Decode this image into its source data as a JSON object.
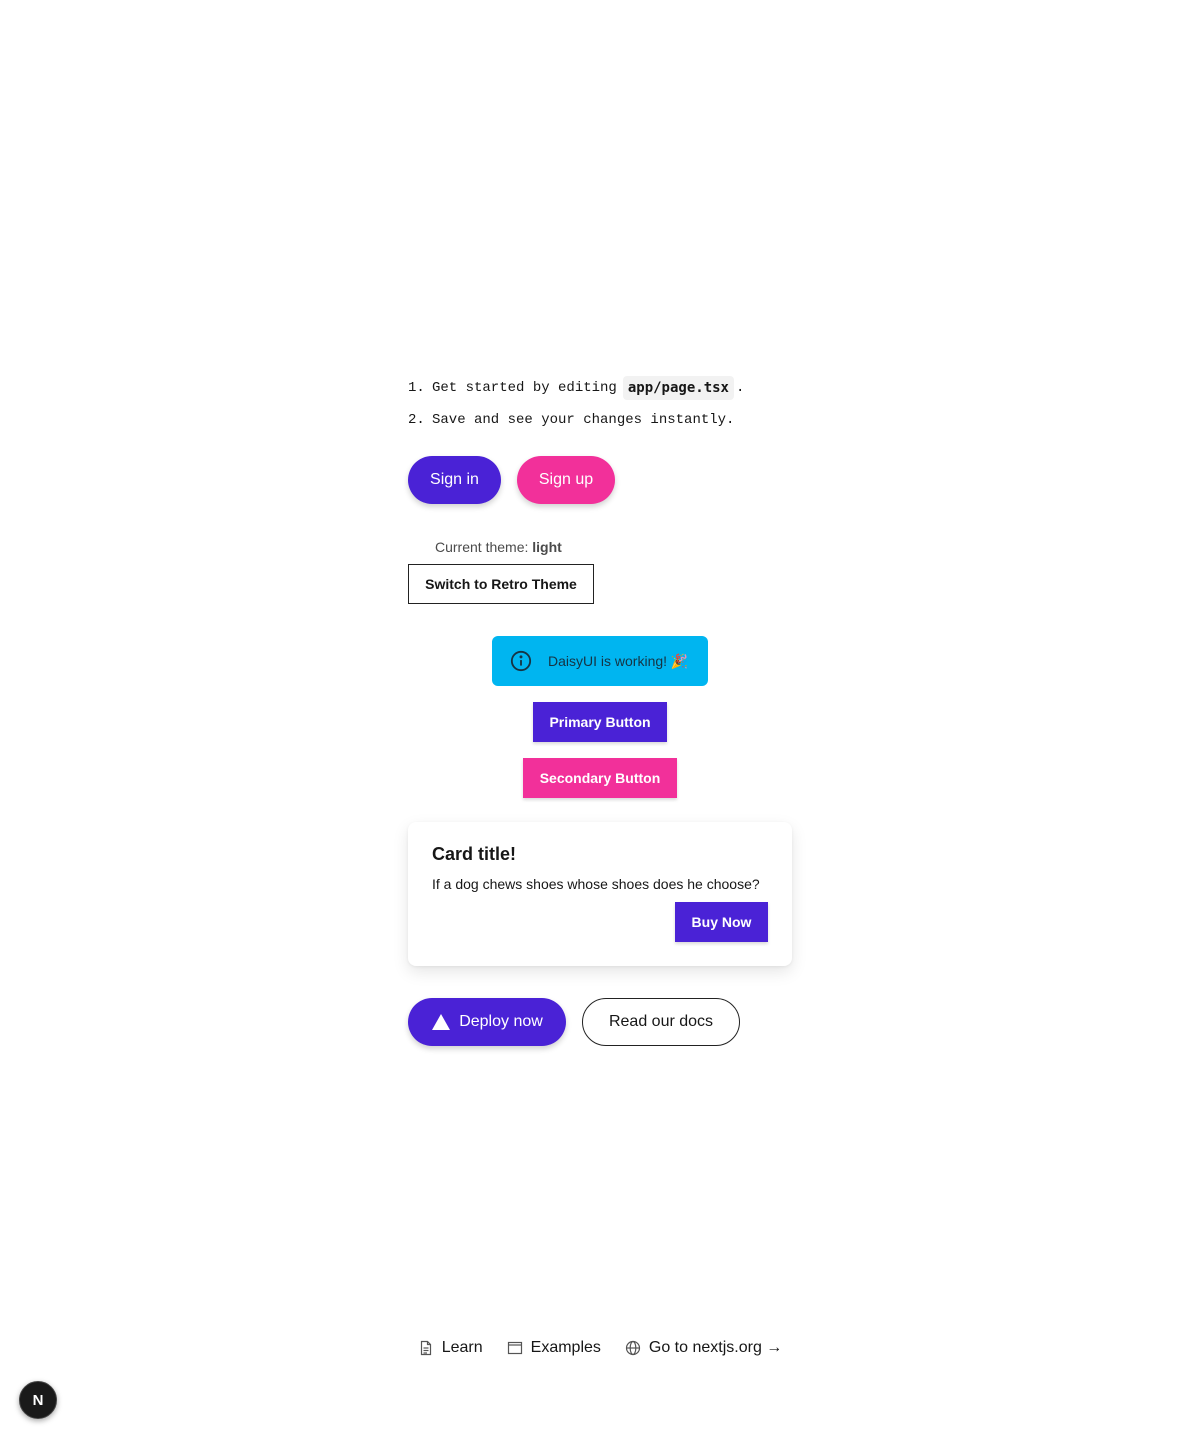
{
  "steps": {
    "item1_num": "1.",
    "item1_before": "Get started by editing",
    "item1_code": "app/page.tsx",
    "item1_after": ".",
    "item2_num": "2.",
    "item2_text": "Save and see your changes instantly."
  },
  "auth": {
    "sign_in": "Sign in",
    "sign_up": "Sign up"
  },
  "theme": {
    "label": "Current theme:",
    "value": "light",
    "switch_label": "Switch to Retro Theme"
  },
  "alert": {
    "text": "DaisyUI is working! 🎉",
    "icon": "info-icon",
    "color": "#00b5f0"
  },
  "buttons": {
    "primary": "Primary Button",
    "secondary": "Secondary Button"
  },
  "card": {
    "title": "Card title!",
    "text": "If a dog chews shoes whose shoes does he choose?",
    "action": "Buy Now"
  },
  "cta": {
    "deploy": "Deploy now",
    "docs": "Read our docs"
  },
  "footer": {
    "learn": "Learn",
    "examples": "Examples",
    "nextjs": "Go to nextjs.org →"
  },
  "badge": {
    "letter": "N"
  },
  "colors": {
    "primary": "#4a22d6",
    "secondary": "#f2309a",
    "info": "#00b5f0"
  }
}
